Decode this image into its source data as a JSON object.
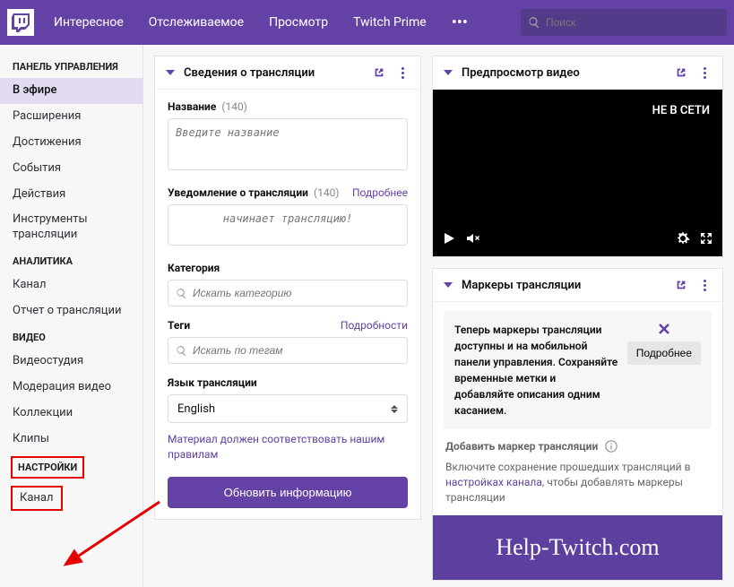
{
  "nav": {
    "items": [
      "Интересное",
      "Отслеживаемое",
      "Просмотр",
      "Twitch Prime"
    ],
    "search_placeholder": "Поиск"
  },
  "sidebar": {
    "sections": [
      {
        "title": "ПАНЕЛЬ УПРАВЛЕНИЯ",
        "items": [
          "В эфире",
          "Расширения",
          "Достижения",
          "События",
          "Действия",
          "Инструменты трансляции"
        ]
      },
      {
        "title": "АНАЛИТИКА",
        "items": [
          "Канал",
          "Отчет о трансляции"
        ]
      },
      {
        "title": "ВИДЕО",
        "items": [
          "Видеостудия",
          "Модерация видео",
          "Коллекции",
          "Клипы"
        ]
      },
      {
        "title": "НАСТРОЙКИ",
        "items": [
          "Канал"
        ]
      }
    ]
  },
  "stream_info": {
    "title": "Сведения о трансляции",
    "name_label": "Название",
    "name_count": "(140)",
    "name_placeholder": "Введите название",
    "notif_label": "Уведомление о трансляции",
    "notif_count": "(140)",
    "notif_more": "Подробнее",
    "notif_placeholder": "начинает трансляцию!",
    "category_label": "Категория",
    "category_placeholder": "Искать категорию",
    "tags_label": "Теги",
    "tags_more": "Подробности",
    "tags_placeholder": "Искать по тегам",
    "lang_label": "Язык трансляции",
    "lang_value": "English",
    "rules_note": "Материал должен соответствовать нашим правилам",
    "update_btn": "Обновить информацию"
  },
  "preview": {
    "title": "Предпросмотр видео",
    "offline": "НЕ В СЕТИ"
  },
  "markers": {
    "title": "Маркеры трансляции",
    "notice": "Теперь маркеры трансляции доступны и на мобильной панели управления. Сохраняйте временные метки и добавляйте описания одним касанием.",
    "notice_btn": "Подробнее",
    "add_label": "Добавить маркер трансляции",
    "info_pre": "Включите сохранение прошедших трансляций в ",
    "info_link": "настройках канала",
    "info_post": ", чтобы добавлять маркеры трансляции"
  },
  "watermark": "Help-Twitch.com"
}
